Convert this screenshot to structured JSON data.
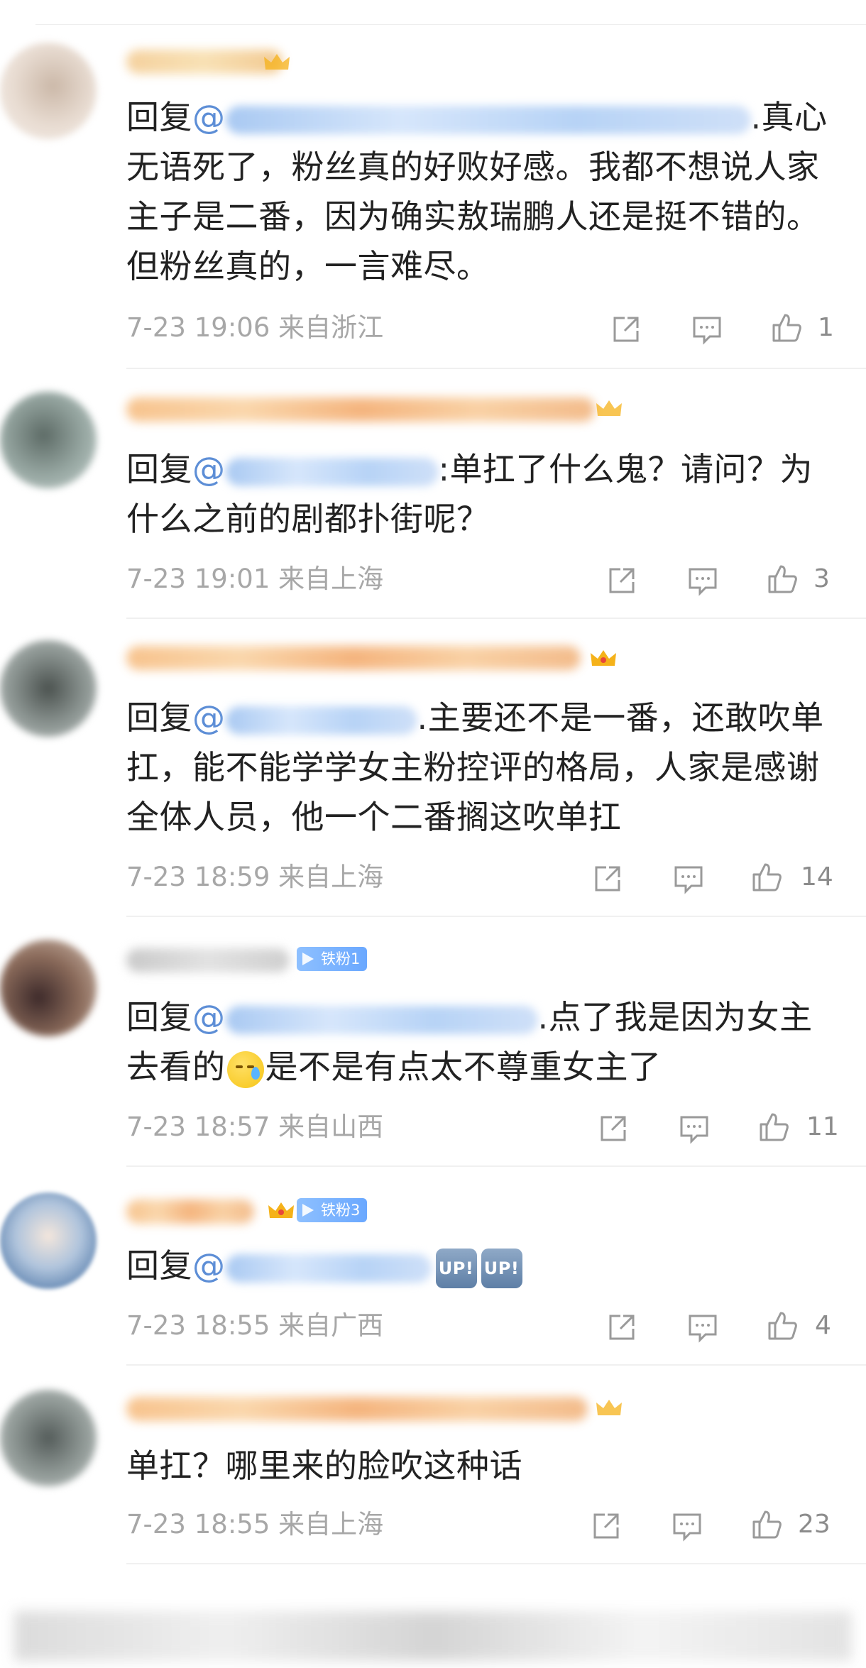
{
  "comments": [
    {
      "text_before": "回复",
      "text_after": ".真心无语死了，粉丝真的好败好感。我都不想说人家主子是二番，因为确实敖瑞鹏人还是挺不错的。但粉丝真的，一言难尽。",
      "time": "7-23 19:06",
      "location": "来自浙江",
      "likes": "1"
    },
    {
      "text_before": "回复",
      "text_after": ":单扛了什么鬼？请问？为什么之前的剧都扑街呢？",
      "time": "7-23 19:01",
      "location": "来自上海",
      "likes": "3"
    },
    {
      "text_before": "回复",
      "text_after": ".主要还不是一番，还敢吹单扛，能不能学学女主粉控评的格局，人家是感谢全体人员，他一个二番搁这吹单扛",
      "time": "7-23 18:59",
      "location": "来自上海",
      "likes": "14"
    },
    {
      "badge": "铁粉1",
      "text_before": "回复",
      "text_mid": ".点了我是因为女主去看的",
      "text_after": "是不是有点太不尊重女主了",
      "time": "7-23 18:57",
      "location": "来自山西",
      "likes": "11"
    },
    {
      "badge": "铁粉3",
      "text_before": "回复",
      "up_label": "UP!",
      "time": "7-23 18:55",
      "location": "来自广西",
      "likes": "4"
    },
    {
      "text_after": "单扛？哪里来的脸吹这种话",
      "time": "7-23 18:55",
      "location": "来自上海",
      "likes": "23"
    }
  ],
  "icons": [
    "share-icon",
    "comment-icon",
    "like-icon",
    "crown-icon"
  ],
  "colors": {
    "meta": "#a7a7a7",
    "mention": "#5d8ed6",
    "fan_badge": "#6aa8ff",
    "crown": "#f5b21a"
  }
}
